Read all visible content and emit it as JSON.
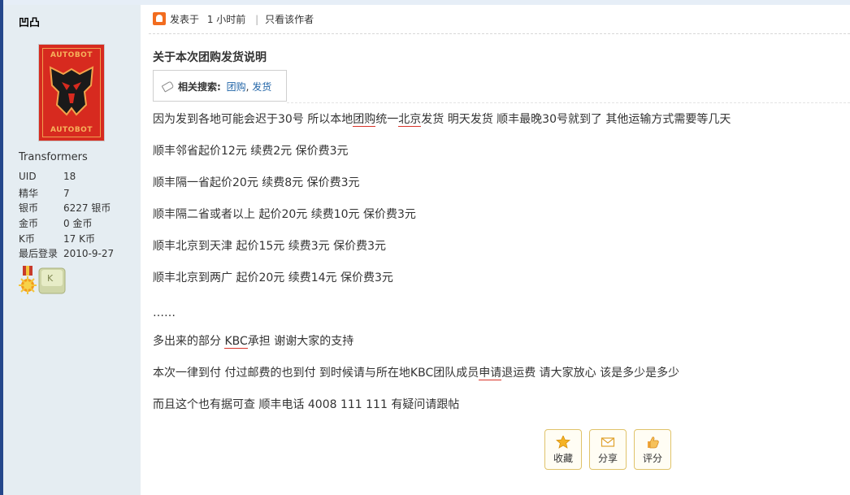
{
  "sidebar": {
    "username": "凹凸",
    "avatar": {
      "top_text": "AUTOBOT",
      "bottom_text": "AUTOBOT"
    },
    "group": "Transformers",
    "stats": [
      {
        "label": "UID",
        "value": "18"
      },
      {
        "label": "精华",
        "value": "7"
      },
      {
        "label": "银币",
        "value": "6227 银币"
      },
      {
        "label": "金币",
        "value": "0 金币"
      },
      {
        "label": "K币",
        "value": "17 K币"
      },
      {
        "label": "最后登录",
        "value": "2010-9-27"
      }
    ],
    "medals": [
      "sun-medal-icon",
      "k-medal-icon"
    ]
  },
  "post": {
    "posted_prefix": "发表于",
    "posted_time": "1 小时前",
    "only_author": "只看该作者",
    "title": "关于本次团购发货说明",
    "tags": {
      "label": "相关搜索:",
      "items": [
        "团购",
        "发货"
      ],
      "sep": ", "
    },
    "paragraphs": [
      {
        "pre": "因为发到各地可能会迟于30号  所以本地",
        "u1": "团购",
        "mid1": "统一",
        "u2": "北京",
        "post": "发货  明天发货  顺丰最晚30号就到了  其他运输方式需要等几天"
      },
      {
        "text": "顺丰邻省起价12元  续费2元  保价费3元"
      },
      {
        "text": "顺丰隔一省起价20元  续费8元  保价费3元"
      },
      {
        "text": "顺丰隔二省或者以上  起价20元  续费10元  保价费3元"
      },
      {
        "text": "顺丰北京到天津  起价15元  续费3元  保价费3元"
      },
      {
        "text": "顺丰北京到两广  起价20元  续费14元  保价费3元"
      },
      {
        "text": "……"
      },
      {
        "pre": "多出来的部分  ",
        "u1": "KBC",
        "post": "承担  谢谢大家的支持"
      },
      {
        "pre": "本次一律到付  付过邮费的也到付  到时候请与所在地KBC团队成员",
        "u1": "申请",
        "post": "退运费  请大家放心  该是多少是多少"
      },
      {
        "text": "而且这个也有据可查  顺丰电话  4008 111 111  有疑问请跟帖"
      }
    ]
  },
  "actions": [
    {
      "label": "收藏",
      "icon": "star-icon"
    },
    {
      "label": "分享",
      "icon": "envelope-icon"
    },
    {
      "label": "评分",
      "icon": "thumbs-up-icon"
    }
  ],
  "colors": {
    "sidebar_bg": "#e5edf2",
    "link": "#2366a8",
    "accent": "#f26c1f",
    "underline": "#d8342a"
  }
}
